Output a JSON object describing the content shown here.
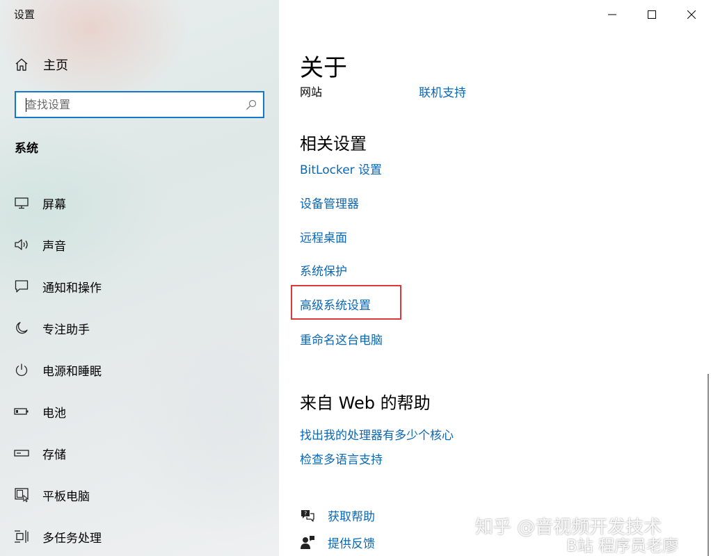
{
  "window": {
    "title": "设置",
    "minimize_icon": "minimize-icon",
    "maximize_icon": "maximize-icon",
    "close_icon": "close-icon"
  },
  "sidebar": {
    "home": {
      "label": "主页",
      "icon": "home-icon"
    },
    "search": {
      "placeholder": "查找设置",
      "value": "",
      "icon": "search-icon"
    },
    "section_title": "系统",
    "items": [
      {
        "label": "屏幕",
        "icon": "display-icon"
      },
      {
        "label": "声音",
        "icon": "speaker-icon"
      },
      {
        "label": "通知和操作",
        "icon": "notification-icon"
      },
      {
        "label": "专注助手",
        "icon": "moon-icon"
      },
      {
        "label": "电源和睡眠",
        "icon": "power-icon"
      },
      {
        "label": "电池",
        "icon": "battery-icon"
      },
      {
        "label": "存储",
        "icon": "storage-icon"
      },
      {
        "label": "平板电脑",
        "icon": "tablet-icon"
      },
      {
        "label": "多任务处理",
        "icon": "multitasking-icon"
      }
    ]
  },
  "main": {
    "title": "关于",
    "website_label": "网站",
    "online_support": "联机支持",
    "related": {
      "title": "相关设置",
      "links": [
        "BitLocker 设置",
        "设备管理器",
        "远程桌面",
        "系统保护",
        "高级系统设置",
        "重命名这台电脑"
      ]
    },
    "web_help": {
      "title": "来自 Web 的帮助",
      "links": [
        "找出我的处理器有多少个核心",
        "检查多语言支持"
      ]
    },
    "get_help": {
      "label": "获取帮助",
      "icon": "help-chat-icon"
    },
    "feedback": {
      "label": "提供反馈",
      "icon": "feedback-icon"
    }
  },
  "watermark": {
    "line1": "知乎 @音视频开发技术",
    "line2": "B站 程序员老廖"
  },
  "colors": {
    "accent": "#0a67b5",
    "search_border": "#1378c9",
    "highlight_box": "#d9383a"
  }
}
